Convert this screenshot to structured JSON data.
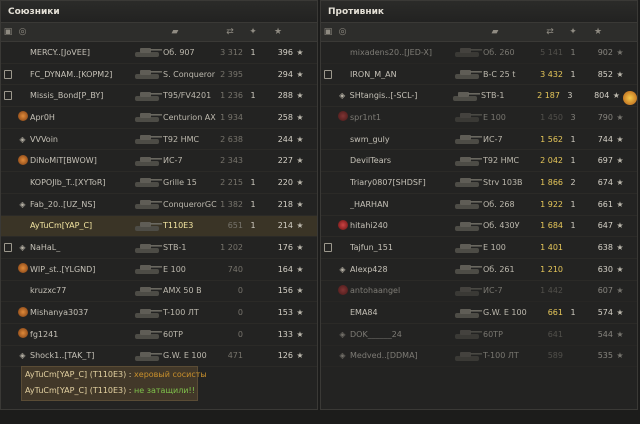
{
  "allies": {
    "title": "Союзники",
    "players": [
      {
        "icon": "",
        "name": "MERCY..[JoVEE]",
        "vehicle": "Об. 907",
        "damage": "3 312",
        "kills": "1",
        "xp": "396",
        "dead": false
      },
      {
        "icon": "",
        "name": "FC_DYNAM..[KOPM2]",
        "vehicle": "S. Conqueror",
        "damage": "2 395",
        "kills": "",
        "xp": "294",
        "dead": false
      },
      {
        "icon": "",
        "name": "Missis_Bond[P_BY]",
        "vehicle": "T95/FV4201",
        "damage": "1 236",
        "kills": "1",
        "xp": "288",
        "dead": false
      },
      {
        "icon": "clan",
        "name": "Apr0H",
        "vehicle": "Centurion AX",
        "damage": "1 934",
        "kills": "",
        "xp": "258",
        "dead": false
      },
      {
        "icon": "diamond",
        "name": "VVVoin",
        "vehicle": "T92 HMC",
        "damage": "2 638",
        "kills": "",
        "xp": "244",
        "dead": false
      },
      {
        "icon": "clan",
        "name": "DiNoMiT[BWOW]",
        "vehicle": "ИС-7",
        "damage": "2 343",
        "kills": "",
        "xp": "227",
        "dead": false
      },
      {
        "icon": "",
        "name": "KOPOJlb_T..[XYToR]",
        "vehicle": "Grille 15",
        "damage": "2 215",
        "kills": "1",
        "xp": "220",
        "dead": false
      },
      {
        "icon": "diamond",
        "name": "Fab_20..[UZ_NS]",
        "vehicle": "ConquerorGC",
        "damage": "1 382",
        "kills": "1",
        "xp": "218",
        "dead": false
      },
      {
        "icon": "",
        "name": "AyTuCm[YAP_C]",
        "vehicle": "T110E3",
        "damage": "651",
        "kills": "1",
        "xp": "214",
        "dead": false,
        "highlight": true
      },
      {
        "icon": "diamond",
        "name": "NaHaL_",
        "vehicle": "STB-1",
        "damage": "1 202",
        "kills": "",
        "xp": "176",
        "dead": false
      },
      {
        "icon": "clan",
        "name": "WIP_st..[YLGND]",
        "vehicle": "E 100",
        "damage": "740",
        "kills": "",
        "xp": "164",
        "dead": false
      },
      {
        "icon": "",
        "name": "kruzxc77",
        "vehicle": "AMX 50 B",
        "damage": "0",
        "kills": "",
        "xp": "156",
        "dead": false
      },
      {
        "icon": "clan",
        "name": "Mishanya3037",
        "vehicle": "T-100 ЛТ",
        "damage": "0",
        "kills": "",
        "xp": "153",
        "dead": false
      },
      {
        "icon": "clan",
        "name": "fg1241",
        "vehicle": "60TP",
        "damage": "0",
        "kills": "",
        "xp": "133",
        "dead": false
      },
      {
        "icon": "diamond",
        "name": "Shock1..[TAK_T]",
        "vehicle": "G.W. E 100",
        "damage": "471",
        "kills": "",
        "xp": "126",
        "dead": false
      }
    ]
  },
  "enemies": {
    "title": "Противник",
    "players": [
      {
        "icon": "",
        "name": "mixadens20..[JED-X]",
        "vehicle": "Об. 260",
        "damage": "5 141",
        "kills": "1",
        "xp": "902",
        "dead": true
      },
      {
        "icon": "",
        "name": "IRON_M_AN",
        "vehicle": "B-C 25 t",
        "damage": "3 432",
        "kills": "1",
        "xp": "852",
        "dead": false
      },
      {
        "icon": "diamond",
        "name": "SHtangis..[-SCL-]",
        "vehicle": "STB-1",
        "damage": "2 187",
        "kills": "3",
        "xp": "804",
        "dead": false,
        "medal": true
      },
      {
        "icon": "clan",
        "name": "spr1nt1",
        "vehicle": "E 100",
        "damage": "1 450",
        "kills": "3",
        "xp": "790",
        "dead": true
      },
      {
        "icon": "",
        "name": "swm_guly",
        "vehicle": "ИС-7",
        "damage": "1 562",
        "kills": "1",
        "xp": "744",
        "dead": false
      },
      {
        "icon": "",
        "name": "DevilTears",
        "vehicle": "T92 HMC",
        "damage": "2 042",
        "kills": "1",
        "xp": "697",
        "dead": false
      },
      {
        "icon": "",
        "name": "Triary0807[SHDSF]",
        "vehicle": "Strv 103B",
        "damage": "1 866",
        "kills": "2",
        "xp": "674",
        "dead": false
      },
      {
        "icon": "",
        "name": "_HARHAN",
        "vehicle": "Об. 268",
        "damage": "1 922",
        "kills": "1",
        "xp": "661",
        "dead": false
      },
      {
        "icon": "clan",
        "name": "hitahi240",
        "vehicle": "Об. 430У",
        "damage": "1 684",
        "kills": "1",
        "xp": "647",
        "dead": false
      },
      {
        "icon": "",
        "name": "Tajfun_151",
        "vehicle": "E 100",
        "damage": "1 401",
        "kills": "",
        "xp": "638",
        "dead": false
      },
      {
        "icon": "diamond",
        "name": "Alexp428",
        "vehicle": "Об. 261",
        "damage": "1 210",
        "kills": "",
        "xp": "630",
        "dead": false
      },
      {
        "icon": "clan",
        "name": "antohaangel",
        "vehicle": "ИС-7",
        "damage": "1 442",
        "kills": "",
        "xp": "607",
        "dead": true
      },
      {
        "icon": "",
        "name": "EMA84",
        "vehicle": "G.W. E 100",
        "damage": "661",
        "kills": "1",
        "xp": "574",
        "dead": false
      },
      {
        "icon": "diamond",
        "name": "DOK______24",
        "vehicle": "60TP",
        "damage": "641",
        "kills": "",
        "xp": "544",
        "dead": true
      },
      {
        "icon": "diamond",
        "name": "Medved..[DDMA]",
        "vehicle": "T-100 ЛТ",
        "damage": "589",
        "kills": "",
        "xp": "535",
        "dead": true
      }
    ]
  },
  "chat": [
    {
      "author": "AyTuCm[YAP_C] (T110E3) :",
      "message": "херовый сосисты",
      "color": "#c9902c"
    },
    {
      "author": "AyTuCm[YAP_C] (T110E3) :",
      "message": "не затащили!!",
      "color": "#7fc24b"
    }
  ],
  "colors": {
    "panel": "#232322",
    "highlight_row": "#3a3426",
    "xp": "#d5d1c7",
    "chat_bg": "#483c2a"
  }
}
